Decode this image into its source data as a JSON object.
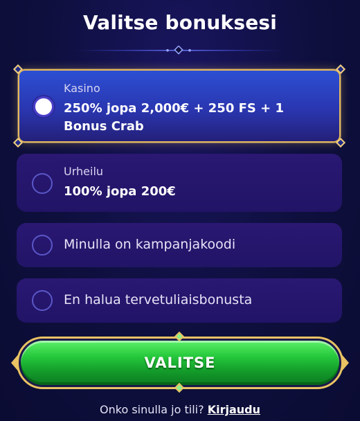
{
  "header": {
    "title": "Valitse bonuksesi"
  },
  "options": [
    {
      "category": "Kasino",
      "label": "250% jopa 2,000€ + 250 FS + 1 Bonus Crab",
      "selected": true
    },
    {
      "category": "Urheilu",
      "label": "100% jopa 200€",
      "selected": false
    },
    {
      "category": "",
      "label": "Minulla on kampanjakoodi",
      "selected": false
    },
    {
      "category": "",
      "label": "En halua tervetuliaisbonusta",
      "selected": false
    }
  ],
  "cta": {
    "label": "VALITSE"
  },
  "footer": {
    "question": "Onko sinulla jo tili?",
    "link": "Kirjaudu"
  },
  "colors": {
    "background": "#0e0f3d",
    "selected_option": "#2c4fd3",
    "option": "#2a1873",
    "gold_border": "#e6b95a",
    "cta_green": "#26c93c"
  }
}
